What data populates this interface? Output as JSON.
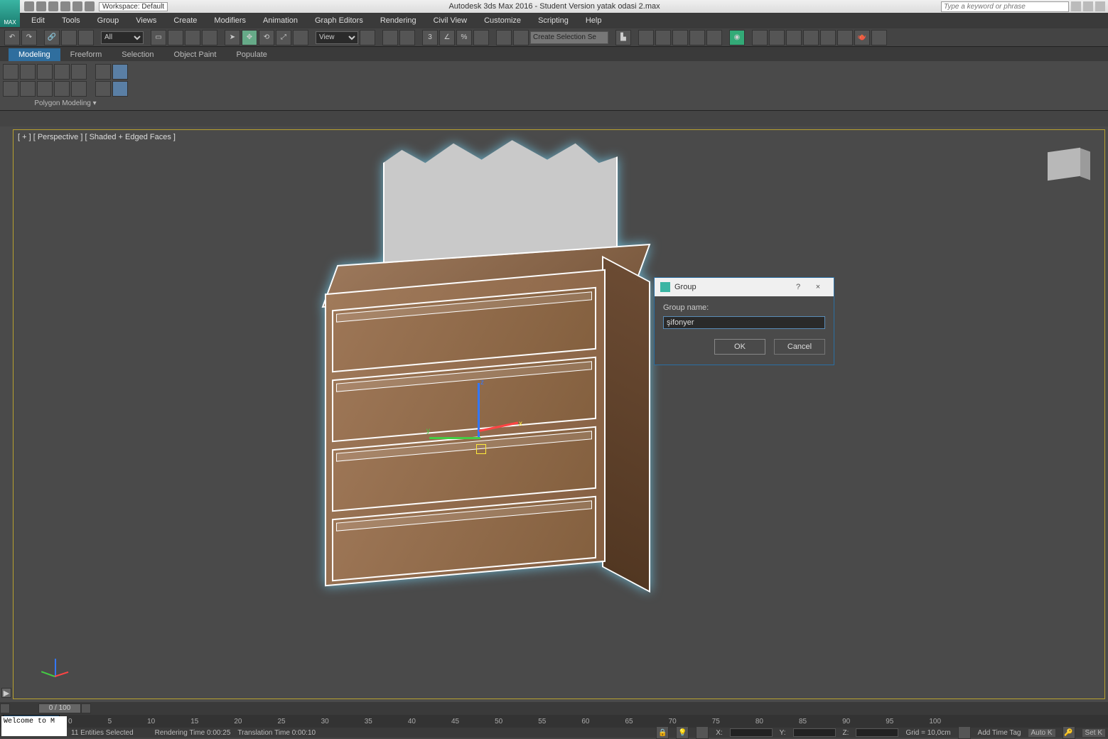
{
  "app": {
    "logo_text": "MAX",
    "title_center": "Autodesk 3ds Max 2016 - Student Version     yatak odasi 2.max",
    "workspace": "Workspace: Default",
    "search_placeholder": "Type a keyword or phrase"
  },
  "menu": [
    "Edit",
    "Tools",
    "Group",
    "Views",
    "Create",
    "Modifiers",
    "Animation",
    "Graph Editors",
    "Rendering",
    "Civil View",
    "Customize",
    "Scripting",
    "Help"
  ],
  "toolbar": {
    "filter_all": "All",
    "view_combo": "View",
    "create_sel": "Create Selection Se"
  },
  "ribbon": {
    "tabs": [
      "Modeling",
      "Freeform",
      "Selection",
      "Object Paint",
      "Populate"
    ],
    "active": 0,
    "group_label": "Polygon Modeling ▾"
  },
  "viewport": {
    "label": "[ + ] [ Perspective ]  [ Shaded + Edged Faces ]",
    "axes": {
      "x": "x",
      "y": "y",
      "z": "z"
    }
  },
  "dialog": {
    "title": "Group",
    "help": "?",
    "close": "×",
    "label": "Group name:",
    "value": "şifonyer",
    "ok": "OK",
    "cancel": "Cancel"
  },
  "timeslider": {
    "pos": "0 / 100",
    "ticks": [
      "0",
      "5",
      "10",
      "15",
      "20",
      "25",
      "30",
      "35",
      "40",
      "45",
      "50",
      "55",
      "60",
      "65",
      "70",
      "75",
      "80",
      "85",
      "90",
      "95",
      "100"
    ]
  },
  "status": {
    "selection": "11 Entities Selected",
    "render_time": "Rendering Time  0:00:25",
    "trans_time": "Translation Time  0:00:10",
    "x": "X:",
    "y": "Y:",
    "z": "Z:",
    "grid": "Grid = 10,0cm",
    "add_tag": "Add Time Tag",
    "autokey": "Auto K",
    "setkey": "Set K",
    "welcome": "Welcome to M"
  }
}
